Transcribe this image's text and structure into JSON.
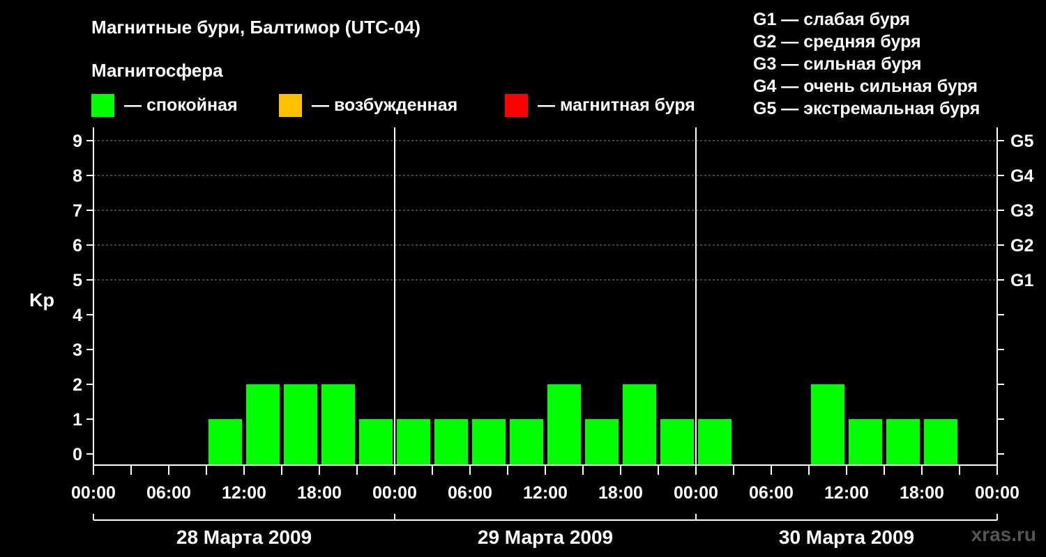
{
  "chart_data": {
    "type": "bar",
    "title": "Магнитные бури, Балтимор (UTC-04)",
    "legend_title": "Магнитосфера",
    "legend": [
      {
        "label": "— спокойная",
        "color": "#00ff00"
      },
      {
        "label": "— возбужденная",
        "color": "#ffc000"
      },
      {
        "label": "— магнитная буря",
        "color": "#ff0000"
      }
    ],
    "storm_scale": [
      "G1 — слабая буря",
      "G2 — средняя буря",
      "G3 — сильная буря",
      "G4 — очень сильная буря",
      "G5 — экстремальная буря"
    ],
    "ylabel": "Kp",
    "ylim": [
      0,
      9
    ],
    "yticks": [
      "0",
      "1",
      "2",
      "3",
      "4",
      "5",
      "6",
      "7",
      "8",
      "9"
    ],
    "right_ticks": [
      {
        "kp": 5,
        "label": "G1"
      },
      {
        "kp": 6,
        "label": "G2"
      },
      {
        "kp": 7,
        "label": "G3"
      },
      {
        "kp": 8,
        "label": "G4"
      },
      {
        "kp": 9,
        "label": "G5"
      }
    ],
    "gridlines_at": [
      5,
      6,
      7,
      8,
      9
    ],
    "xtick_labels": [
      "00:00",
      "06:00",
      "12:00",
      "18:00",
      "00:00",
      "06:00",
      "12:00",
      "18:00",
      "00:00",
      "06:00",
      "12:00",
      "18:00",
      "00:00"
    ],
    "days": [
      "28 Марта 2009",
      "29 Марта 2009",
      "30 Марта 2009"
    ],
    "interval_hours": 3,
    "values": [
      null,
      null,
      null,
      1,
      2,
      2,
      2,
      1,
      1,
      1,
      1,
      1,
      2,
      1,
      2,
      1,
      1,
      null,
      null,
      2,
      1,
      1,
      1,
      null
    ],
    "bar_color": "#00ff00",
    "grid": true
  },
  "watermark": "xras.ru"
}
